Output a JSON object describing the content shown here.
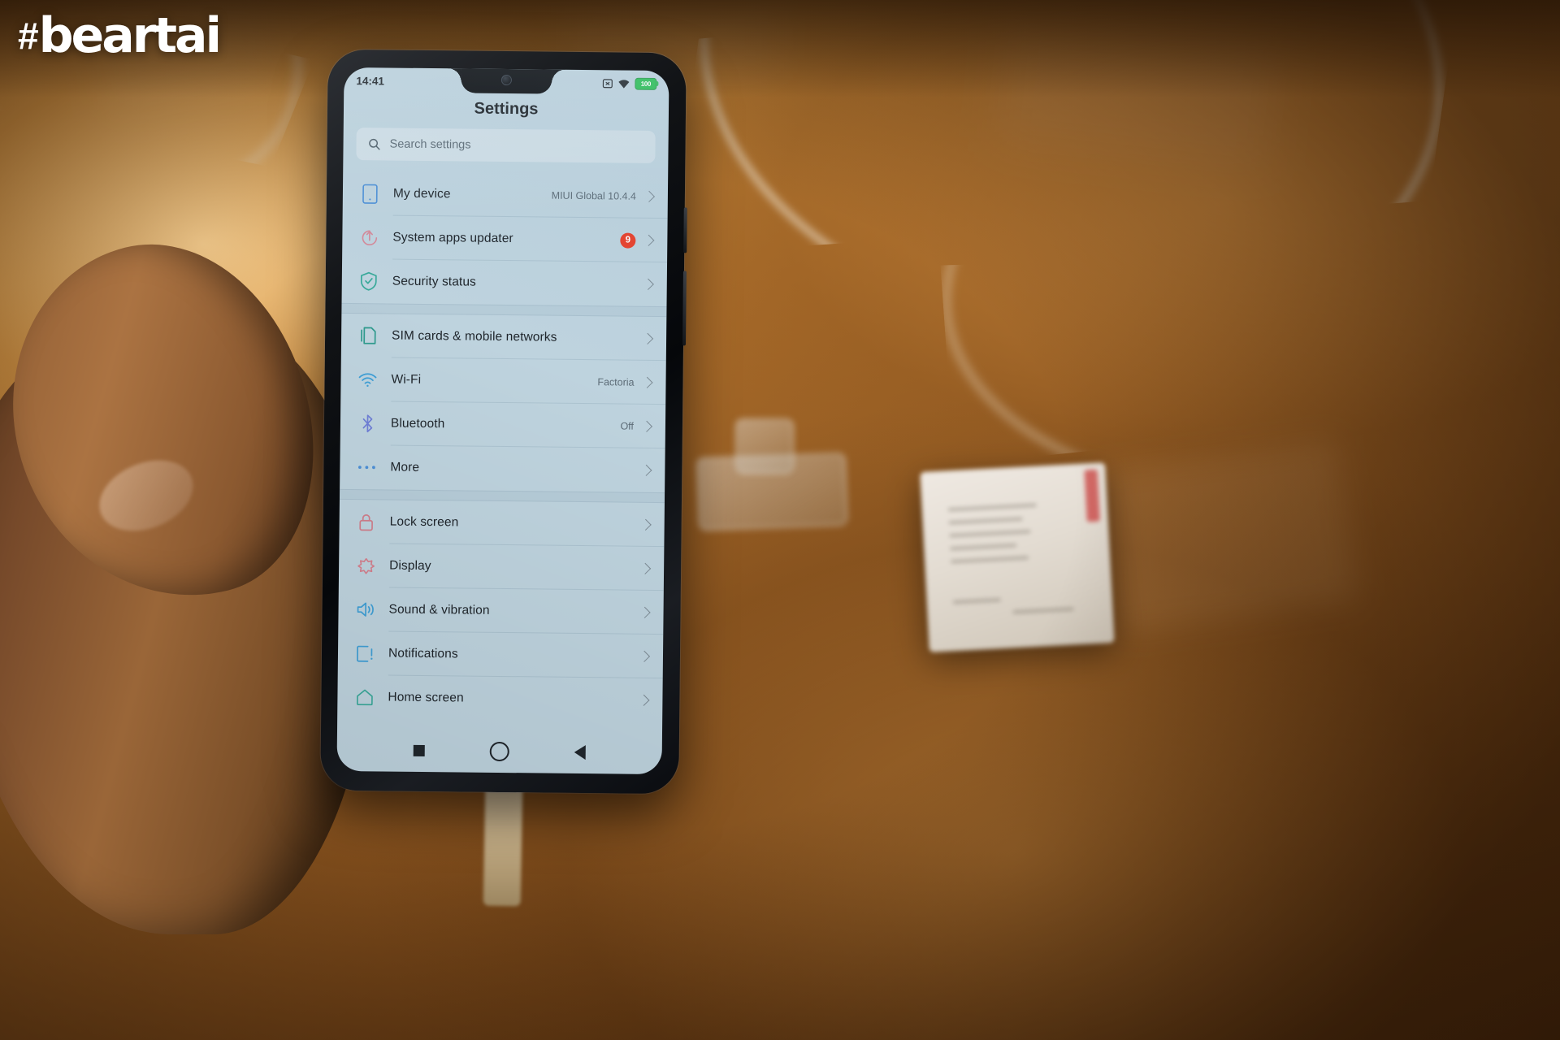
{
  "watermark": {
    "hash": "#",
    "text": "beartai"
  },
  "phone": {
    "statusbar": {
      "time": "14:41",
      "icons": [
        {
          "name": "no-sim-icon",
          "label": "no-sim"
        },
        {
          "name": "wifi-icon",
          "label": "wifi"
        }
      ],
      "battery_level": "100"
    },
    "title": "Settings",
    "search": {
      "placeholder": "Search settings",
      "icon": "search-icon"
    },
    "groups": [
      {
        "id": "device-group",
        "rows": [
          {
            "icon": "phone-outline-icon",
            "label": "My device",
            "value": "MIUI Global 10.4.4",
            "badge": "",
            "color": "#4c8fd6"
          },
          {
            "icon": "update-arrow-icon",
            "label": "System apps updater",
            "value": "",
            "badge": "9",
            "color": "#d48a9a"
          },
          {
            "icon": "shield-check-icon",
            "label": "Security status",
            "value": "",
            "badge": "",
            "color": "#39a99a"
          }
        ]
      },
      {
        "id": "connectivity-group",
        "rows": [
          {
            "icon": "sim-cards-icon",
            "label": "SIM cards & mobile networks",
            "value": "",
            "badge": "",
            "color": "#2f9b8e"
          },
          {
            "icon": "wifi-icon",
            "label": "Wi-Fi",
            "value": "Factoria",
            "badge": "",
            "color": "#3f9fd6"
          },
          {
            "icon": "bluetooth-icon",
            "label": "Bluetooth",
            "value": "Off",
            "badge": "",
            "color": "#6f7fd6"
          },
          {
            "icon": "more-dots-icon",
            "label": "More",
            "value": "",
            "badge": "",
            "color": "#4c8fd6"
          }
        ]
      },
      {
        "id": "personalization-group",
        "rows": [
          {
            "icon": "lock-icon",
            "label": "Lock screen",
            "value": "",
            "badge": "",
            "color": "#d07f8c"
          },
          {
            "icon": "brightness-icon",
            "label": "Display",
            "value": "",
            "badge": "",
            "color": "#d4808e"
          },
          {
            "icon": "sound-icon",
            "label": "Sound & vibration",
            "value": "",
            "badge": "",
            "color": "#3f9fd6"
          },
          {
            "icon": "notifications-icon",
            "label": "Notifications",
            "value": "",
            "badge": "",
            "color": "#3f9fd6"
          },
          {
            "icon": "home-icon",
            "label": "Home screen",
            "value": "",
            "badge": "",
            "color": "#39a99a"
          }
        ]
      }
    ],
    "navbar": [
      {
        "name": "nav-recents-button",
        "shape": "square"
      },
      {
        "name": "nav-home-button",
        "shape": "circle"
      },
      {
        "name": "nav-back-button",
        "shape": "triangle"
      }
    ]
  },
  "colors": {
    "screen_bg": "#bed3de",
    "accent_badge": "#e8412c",
    "battery_green": "#2bbf55",
    "text_primary": "#1e242a",
    "text_secondary": "#5d6c77"
  }
}
